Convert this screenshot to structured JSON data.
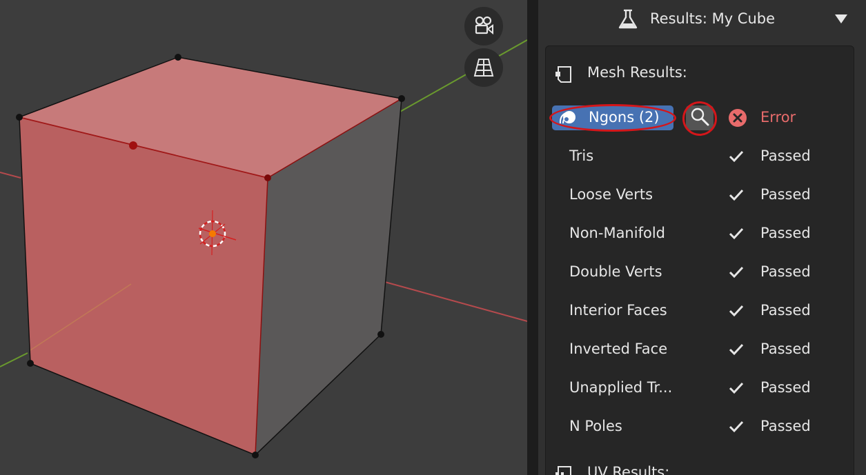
{
  "viewport": {
    "nav_icons": [
      "camera-icon",
      "grid-perspective-icon"
    ],
    "colors": {
      "background": "#3d3d3d",
      "face_selected": "#c06868",
      "face_side": "#5a5858",
      "x_axis": "#b54a4d",
      "y_axis": "#6a9a2e",
      "vertex": "#111111",
      "selected_vertex": "#8b0000"
    }
  },
  "sidebar": {
    "header": {
      "title": "Results: My Cube",
      "icon": "flask-icon",
      "expand_icon": "triangle-down-icon"
    },
    "mesh_results": {
      "label": "Mesh Results:",
      "icon": "mesh-square-icon",
      "ngons_button_label": "Ngons (2)",
      "ngons_icon": "ngon-shape-icon",
      "search_icon": "magnifier-icon",
      "error_status": "Error",
      "checks": [
        {
          "name": "Tris",
          "status": "Passed"
        },
        {
          "name": "Loose Verts",
          "status": "Passed"
        },
        {
          "name": "Non-Manifold",
          "status": "Passed"
        },
        {
          "name": "Double Verts",
          "status": "Passed"
        },
        {
          "name": "Interior Faces",
          "status": "Passed"
        },
        {
          "name": "Inverted Face",
          "status": "Passed"
        },
        {
          "name": "Unapplied Tr...",
          "status": "Passed"
        },
        {
          "name": "N Poles",
          "status": "Passed"
        }
      ]
    },
    "uv_results": {
      "label": "UV Results:",
      "icon": "checker-icon"
    },
    "colors": {
      "accent": "#4772b3",
      "highlight_ring": "#d4161a",
      "error": "#e86b6b"
    }
  }
}
